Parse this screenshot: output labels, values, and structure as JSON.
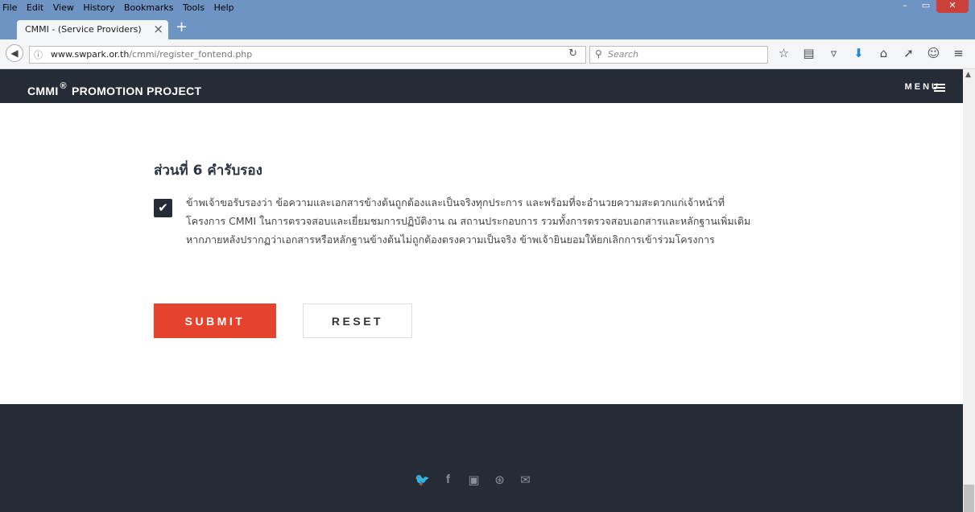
{
  "browser": {
    "menu": [
      "File",
      "Edit",
      "View",
      "History",
      "Bookmarks",
      "Tools",
      "Help"
    ],
    "tab_title": "CMMI - (Service Providers)",
    "tab_close": "×",
    "new_tab": "+",
    "url_domain": "www.swpark.or.th",
    "url_path": "/cmmi/register_fontend.php",
    "search_placeholder": "Search",
    "min": "–",
    "max": "▭",
    "close": "✕"
  },
  "header": {
    "brand_main": "CMMI",
    "brand_reg": "®",
    "brand_rest": "PROMOTION PROJECT",
    "menu_label": "MENU"
  },
  "section": {
    "title": "ส่วนที่ 6 คำรับรอง",
    "lines": [
      "ข้าพเจ้าขอรับรองว่า ข้อความและเอกสารข้างต้นถูกต้องและเป็นจริงทุกประการ และพร้อมที่จะอำนวยความสะดวกแก่เจ้าหน้าที่",
      "โครงการ CMMI ในการตรวจสอบและเยี่ยมชมการปฏิบัติงาน ณ สถานประกอบการ รวมทั้งการตรวจสอบเอกสารและหลักฐานเพิ่มเติม",
      "หากภายหลังปรากฏว่าเอกสารหรือหลักฐานข้างต้นไม่ถูกต้องตรงความเป็นจริง ข้าพเจ้ายินยอมให้ยกเลิกการเข้าร่วมโครงการ"
    ],
    "checked": true
  },
  "buttons": {
    "submit": "SUBMIT",
    "reset": "RESET"
  },
  "footer": {
    "social": [
      "twitter-icon",
      "facebook-icon",
      "instagram-icon",
      "dribbble-icon",
      "mail-icon"
    ]
  }
}
